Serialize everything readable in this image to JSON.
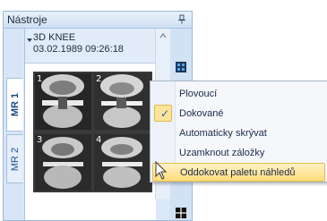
{
  "panel": {
    "title": "Nástroje",
    "pin_icon": "pin-icon",
    "tabs": [
      {
        "label": "MR 1",
        "active": true
      },
      {
        "label": "MR 2",
        "active": false
      }
    ]
  },
  "series": {
    "name": "3D KNEE",
    "datetime": "03.02.1989 09:26:18",
    "thumbnails": [
      {
        "number": "1"
      },
      {
        "number": "2"
      },
      {
        "number": "3"
      },
      {
        "number": "4"
      }
    ]
  },
  "context_menu": {
    "items": [
      {
        "label": "Plovoucí",
        "checked": false,
        "highlighted": false
      },
      {
        "label": "Dokované",
        "checked": true,
        "highlighted": false
      },
      {
        "label": "Automaticky skrývat",
        "checked": false,
        "highlighted": false
      },
      {
        "label": "Uzamknout záložky",
        "checked": false,
        "highlighted": false
      },
      {
        "label": "Oddokovat paletu náhledů",
        "checked": false,
        "highlighted": true
      }
    ]
  },
  "colors": {
    "panel_bg": "#dbe8f7",
    "accent_blue": "#2a62b8",
    "menu_highlight": "#ffdc7a"
  }
}
